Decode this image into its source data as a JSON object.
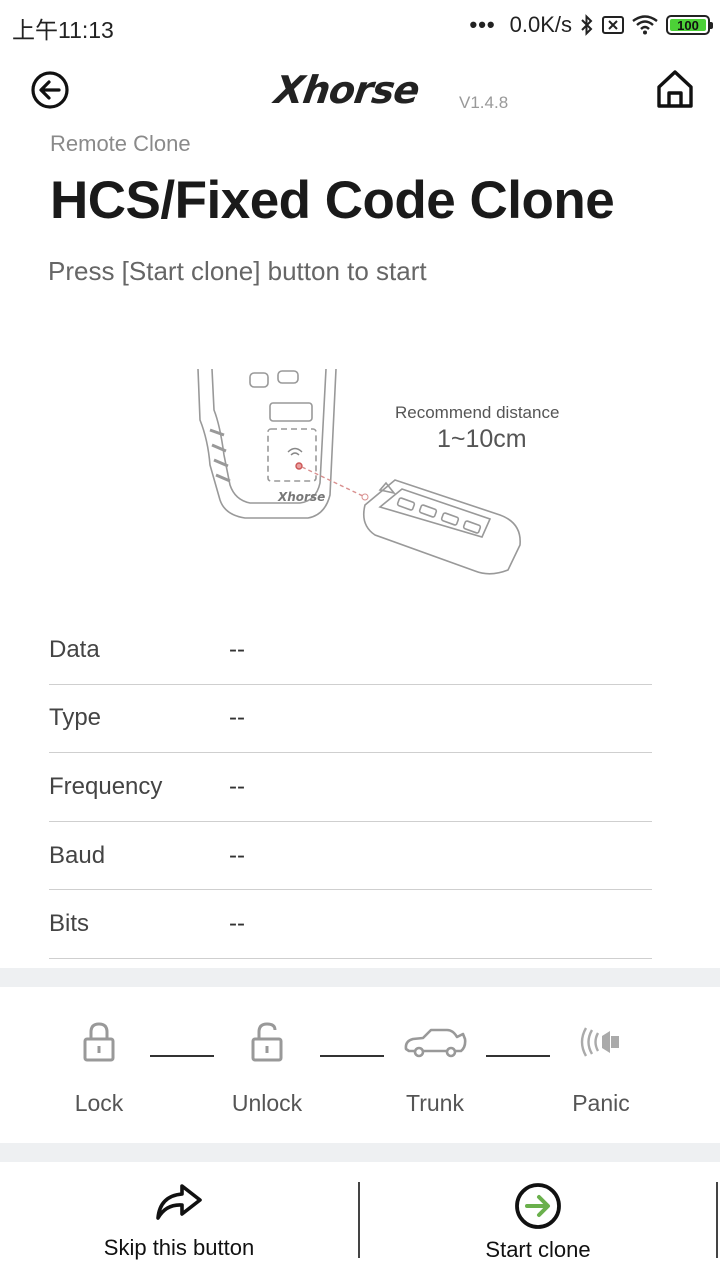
{
  "status_bar": {
    "time": "上午11:13",
    "dots": "•••",
    "network_speed": "0.0K/s",
    "battery": "100",
    "icons": [
      "bluetooth-icon",
      "sim-x-icon",
      "wifi-icon",
      "battery-icon"
    ]
  },
  "header": {
    "logo": "Xhorse",
    "version": "V1.4.8",
    "back_icon": "back-arrow-circle-icon",
    "home_icon": "home-icon"
  },
  "page": {
    "subtitle": "Remote Clone",
    "title": "HCS/Fixed Code Clone",
    "instruction": "Press [Start clone] button to start"
  },
  "illustration": {
    "distance_label": "Recommend distance",
    "distance_value": "1~10cm"
  },
  "info": [
    {
      "label": "Data",
      "value": "--"
    },
    {
      "label": "Type",
      "value": "--"
    },
    {
      "label": "Frequency",
      "value": "--"
    },
    {
      "label": "Baud",
      "value": "--"
    },
    {
      "label": "Bits",
      "value": "--"
    }
  ],
  "buttons": [
    {
      "label": "Lock",
      "icon": "lock-icon"
    },
    {
      "label": "Unlock",
      "icon": "unlock-icon"
    },
    {
      "label": "Trunk",
      "icon": "car-trunk-icon"
    },
    {
      "label": "Panic",
      "icon": "panic-horn-icon"
    }
  ],
  "actions": {
    "skip": "Skip this button",
    "start": "Start clone",
    "accent": "#6ab04c"
  }
}
